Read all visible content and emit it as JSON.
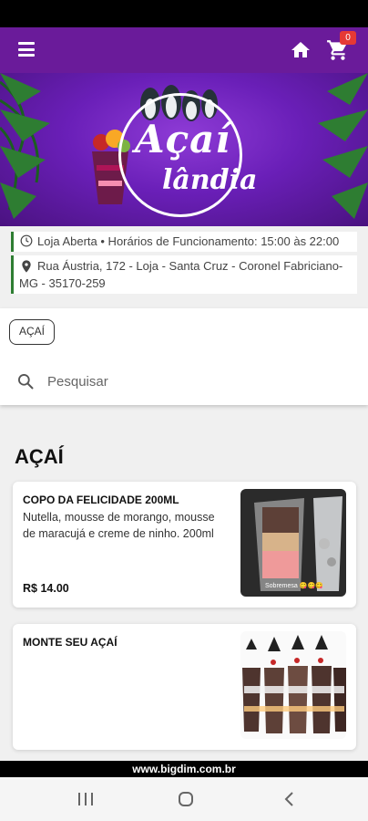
{
  "app_bar": {
    "cart_count": "0",
    "bg_color": "#6a1b9a"
  },
  "banner": {
    "logo_line1": "Açaí",
    "logo_line2": "lândia"
  },
  "store_info": {
    "status": "Loja Aberta • Horários de Funcionamento: 15:00 às 22:00",
    "address": "Rua Áustria, 172 - Loja - Santa Cruz - Coronel Fabriciano-MG - 35170-259"
  },
  "filter": {
    "category_chip": "AÇAÍ",
    "search_placeholder": "Pesquisar"
  },
  "section": {
    "title": "AÇAÍ"
  },
  "products": [
    {
      "name": "COPO DA FELICIDADE 200ML",
      "description": "Nutella, mousse de morango, mousse de maracujá e creme de ninho. 200ml",
      "price": "R$ 14.00",
      "image_caption": "Sobremesa 😋😋😋"
    },
    {
      "name": "MONTE SEU AÇAÍ",
      "description": "",
      "price": ""
    }
  ],
  "footer": {
    "text": "www.bigdim.com.br"
  },
  "icons": {
    "menu": "menu-icon",
    "home": "home-icon",
    "cart": "cart-icon",
    "clock": "clock-icon",
    "location": "location-pin-icon",
    "search": "search-icon"
  }
}
